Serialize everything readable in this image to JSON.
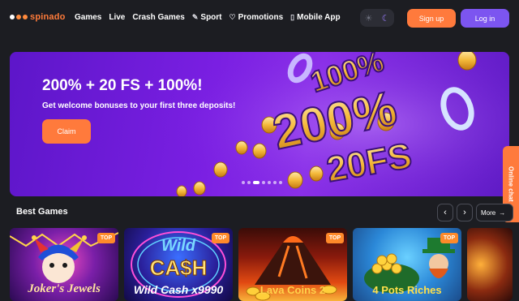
{
  "header": {
    "logo_text": "spinado",
    "nav": [
      {
        "label": "Games",
        "icon": ""
      },
      {
        "label": "Live",
        "icon": ""
      },
      {
        "label": "Crash Games",
        "icon": ""
      },
      {
        "label": "Sport",
        "icon": "sport-icon"
      },
      {
        "label": "Promotions",
        "icon": "heart-icon"
      },
      {
        "label": "Mobile App",
        "icon": "phone-icon"
      }
    ],
    "signup_label": "Sign up",
    "login_label": "Log in"
  },
  "banner": {
    "title": "200% + 20 FS + 100%!",
    "subtitle": "Get welcome bonuses to your first three deposits!",
    "claim_label": "Claim",
    "art_text_1": "100%",
    "art_text_2": "200%",
    "art_text_3": "20FS"
  },
  "online_chat_label": "Online chat",
  "best_games": {
    "title": "Best Games",
    "more_label": "More",
    "games": [
      {
        "title": "Joker's Jewels",
        "badge": "TOP"
      },
      {
        "title": "Wild Cash x9990",
        "badge": "TOP"
      },
      {
        "title": "Lava Coins 2",
        "badge": "TOP"
      },
      {
        "title": "4 Pots Riches",
        "badge": "TOP"
      },
      {
        "title": "",
        "badge": ""
      }
    ]
  },
  "colors": {
    "accent_orange": "#ff7a3c",
    "accent_purple": "#7c55f0",
    "background": "#1c1d22"
  }
}
